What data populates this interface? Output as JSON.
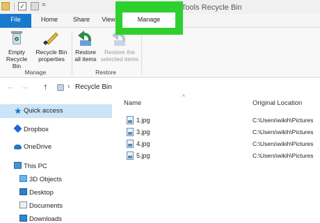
{
  "window": {
    "title": "Recycle Bin Tools  Recycle Bin"
  },
  "quick_access_toolbar": {
    "dropdown_glyph": "=",
    "check_glyph": "✓"
  },
  "tabs": {
    "file": "File",
    "home": "Home",
    "share": "Share",
    "view": "View",
    "manage": "Manage"
  },
  "ribbon": {
    "empty_bin": {
      "line1": "Empty",
      "line2": "Recycle Bin"
    },
    "bin_properties": {
      "line1": "Recycle Bin",
      "line2": "properties"
    },
    "restore_all": {
      "line1": "Restore",
      "line2": "all items"
    },
    "restore_selected": {
      "line1": "Restore the",
      "line2": "selected items"
    },
    "group_manage": "Manage",
    "group_restore": "Restore"
  },
  "address": {
    "back": "←",
    "forward": "→",
    "up": "↑",
    "chevron": "›",
    "path": "Recycle Bin"
  },
  "navpane": {
    "quick_access": "Quick access",
    "dropbox": "Dropbox",
    "onedrive": "OneDrive",
    "this_pc": "This PC",
    "objects3d": "3D Objects",
    "desktop": "Desktop",
    "documents": "Documents",
    "downloads": "Downloads"
  },
  "columns": {
    "name": "Name",
    "original_location": "Original Location",
    "sort_glyph": "^"
  },
  "files": [
    {
      "name": "1.jpg",
      "location": "C:\\Users\\wikih\\Pictures"
    },
    {
      "name": "3.jpg",
      "location": "C:\\Users\\wikih\\Pictures"
    },
    {
      "name": "4.jpg",
      "location": "C:\\Users\\wikih\\Pictures"
    },
    {
      "name": "5.jpg",
      "location": "C:\\Users\\wikih\\Pictures"
    }
  ],
  "colors": {
    "file_tab": "#1979ca",
    "highlight_frame": "#2ed02e",
    "selection": "#cce4f7"
  }
}
